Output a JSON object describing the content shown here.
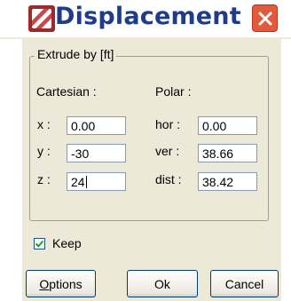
{
  "window": {
    "title": "Displacement",
    "icons": {
      "app": "app-icon",
      "close": "close-icon"
    },
    "colors": {
      "title_text": "#1f3c88",
      "close_button": "#e15a3b",
      "dialog_bg": "#ece9d8"
    }
  },
  "group": {
    "title": "Extrude by [ft]"
  },
  "cartesian": {
    "heading": "Cartesian :",
    "x": {
      "label": "x :",
      "value": "0.00"
    },
    "y": {
      "label": "y :",
      "value": "-30"
    },
    "z": {
      "label": "z :",
      "value": "24"
    }
  },
  "polar": {
    "heading": "Polar :",
    "hor": {
      "label": "hor :",
      "value": "0.00"
    },
    "ver": {
      "label": "ver :",
      "value": "38.66"
    },
    "dist": {
      "label": "dist :",
      "value": "38.42"
    }
  },
  "keep": {
    "label": "Keep",
    "checked": true
  },
  "buttons": {
    "options_prefix": "O",
    "options_rest": "ptions",
    "ok": "Ok",
    "cancel": "Cancel"
  }
}
